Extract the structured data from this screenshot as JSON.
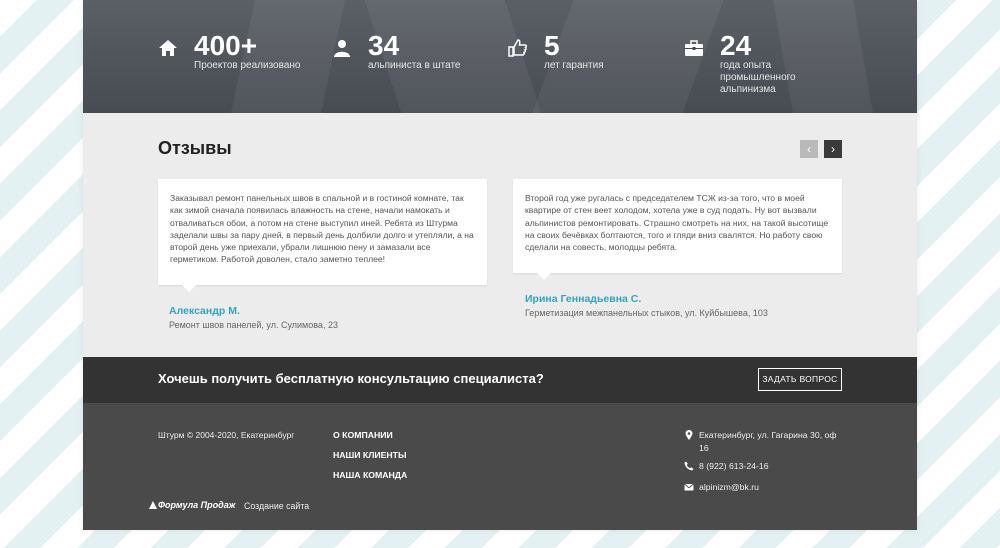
{
  "stats": [
    {
      "icon": "home-icon",
      "number": "400+",
      "label": "Проектов реализовано"
    },
    {
      "icon": "user-icon",
      "number": "34",
      "label": "альпиниста в штате"
    },
    {
      "icon": "thumbs-up-icon",
      "number": "5",
      "label": "лет гарантия"
    },
    {
      "icon": "briefcase-icon",
      "number": "24",
      "label": "года опыта промышленного альпинизма"
    }
  ],
  "reviews": {
    "title": "Отзывы",
    "prev_label": "‹",
    "next_label": "›",
    "items": [
      {
        "text": "Заказывал ремонт панельных швов в спальной и в гостиной комнате, так как зимой сначала появилась влажность на стене, начали намокать и отваливаться обои, а потом на стене выступил иней. Ребята из Штурма заделали швы за пару дней, в первый день долбили долго и утепляли, а на второй день уже приехали, убрали лишнюю пену и замазали все герметиком. Работой доволен, стало заметно теплее!",
        "author": "Александр М.",
        "info": "Ремонт швов панелей, ул. Сулимова, 23"
      },
      {
        "text": "Второй год уже ругалась с председателем ТСЖ из-за того, что в моей квартире от стен веет холодом, хотела уже в суд подать. Ну вот вызвали альпинистов ремонтировать. Страшно смотреть на них, на такой высотище на своих бечёвках болтаются, того и гляди вниз свалятся. Но работу свою сделали на совесть, молодцы ребята.",
        "author": "Ирина Геннадьевна С.",
        "info": "Герметизация межпанельных стыков, ул. Куйбышева, 103"
      }
    ]
  },
  "cta": {
    "text": "Хочешь получить бесплатную консультацию специалиста?",
    "button": "ЗАДАТЬ ВОПРОС"
  },
  "footer": {
    "copyright": "Штурм © 2004-2020, Екатеринбург",
    "nav": [
      "О КОМПАНИИ",
      "НАШИ КЛИЕНТЫ",
      "НАША КОМАНДА"
    ],
    "address": "Екатеринбург, ул. Гагарина 30, оф 16",
    "phone": "8 (922) 613-24-16",
    "email": "alpinizm@bk.ru",
    "brand": "Формула Продаж",
    "made": "Создание сайта"
  }
}
